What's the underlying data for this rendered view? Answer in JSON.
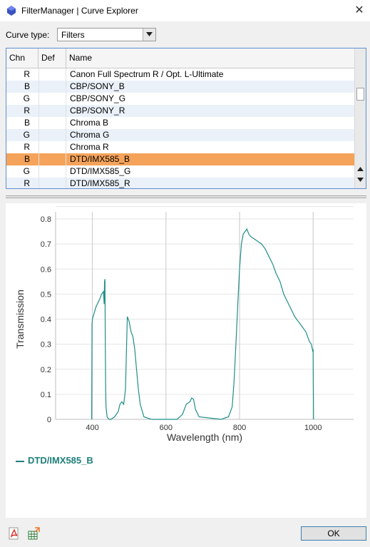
{
  "window": {
    "title": "FilterManager | Curve Explorer",
    "close_glyph": "✕"
  },
  "curve_type": {
    "label": "Curve type:",
    "value": "Filters"
  },
  "table": {
    "headers": {
      "chn": "Chn",
      "def": "Def",
      "name": "Name"
    },
    "rows": [
      {
        "chn": "R",
        "def": "",
        "name": "Canon Full Spectrum R / Opt. L-Ultimate"
      },
      {
        "chn": "B",
        "def": "",
        "name": "CBP/SONY_B"
      },
      {
        "chn": "G",
        "def": "",
        "name": "CBP/SONY_G"
      },
      {
        "chn": "R",
        "def": "",
        "name": "CBP/SONY_R"
      },
      {
        "chn": "B",
        "def": "",
        "name": "Chroma B"
      },
      {
        "chn": "G",
        "def": "",
        "name": "Chroma G"
      },
      {
        "chn": "R",
        "def": "",
        "name": "Chroma R"
      },
      {
        "chn": "B",
        "def": "",
        "name": "DTD/IMX585_B",
        "selected": true
      },
      {
        "chn": "G",
        "def": "",
        "name": "DTD/IMX585_G"
      },
      {
        "chn": "R",
        "def": "",
        "name": "DTD/IMX585_R"
      }
    ],
    "selected_row_color": "#f5a35a",
    "alt_row_color": "#eaf1f9"
  },
  "chart_data": {
    "type": "line",
    "title": "",
    "xlabel": "Wavelength (nm)",
    "ylabel": "Transmission",
    "xlim": [
      300,
      1110
    ],
    "ylim": [
      0,
      0.8
    ],
    "x_ticks": [
      400,
      600,
      800,
      1000
    ],
    "y_ticks": [
      0,
      0.1,
      0.2,
      0.3,
      0.4,
      0.5,
      0.6,
      0.7,
      0.8
    ],
    "x_tick_labels": [
      "400",
      "600",
      "800",
      "1000"
    ],
    "y_tick_labels": [
      "0",
      "0.1",
      "0.2",
      "0.3",
      "0.4",
      "0.5",
      "0.6",
      "0.7",
      "0.8"
    ],
    "grid": "vertical",
    "legend_position": "bottom-left",
    "series": [
      {
        "name": "DTD/IMX585_B",
        "color": "#1f8f88",
        "x": [
          398,
          399,
          400,
          410,
          420,
          425,
          430,
          432,
          433,
          434,
          435,
          436,
          437,
          440,
          445,
          450,
          460,
          470,
          475,
          480,
          485,
          490,
          493,
          495,
          500,
          505,
          510,
          515,
          520,
          525,
          530,
          540,
          560,
          600,
          630,
          645,
          655,
          665,
          670,
          675,
          680,
          690,
          750,
          770,
          780,
          785,
          790,
          795,
          800,
          805,
          810,
          815,
          820,
          825,
          830,
          840,
          850,
          860,
          870,
          880,
          890,
          900,
          910,
          920,
          930,
          940,
          950,
          960,
          970,
          980,
          990,
          995,
          998,
          999,
          1000,
          1001
        ],
        "y": [
          0,
          0.38,
          0.4,
          0.45,
          0.48,
          0.5,
          0.51,
          0.46,
          0.55,
          0.56,
          0.3,
          0.12,
          0.05,
          0.01,
          0,
          0,
          0.01,
          0.03,
          0.06,
          0.07,
          0.06,
          0.12,
          0.3,
          0.41,
          0.39,
          0.35,
          0.33,
          0.28,
          0.2,
          0.12,
          0.06,
          0.01,
          0,
          0,
          0,
          0.02,
          0.06,
          0.07,
          0.085,
          0.08,
          0.04,
          0.01,
          0,
          0.01,
          0.05,
          0.15,
          0.3,
          0.45,
          0.6,
          0.7,
          0.74,
          0.75,
          0.76,
          0.74,
          0.73,
          0.72,
          0.71,
          0.7,
          0.68,
          0.65,
          0.62,
          0.58,
          0.55,
          0.5,
          0.47,
          0.44,
          0.41,
          0.39,
          0.37,
          0.35,
          0.31,
          0.3,
          0.28,
          0.27,
          0.28,
          0
        ]
      }
    ]
  },
  "buttons": {
    "ok": "OK"
  },
  "icons": {
    "app": "app-logo-icon",
    "pdf": "pdf-export-icon",
    "export": "data-export-icon"
  }
}
